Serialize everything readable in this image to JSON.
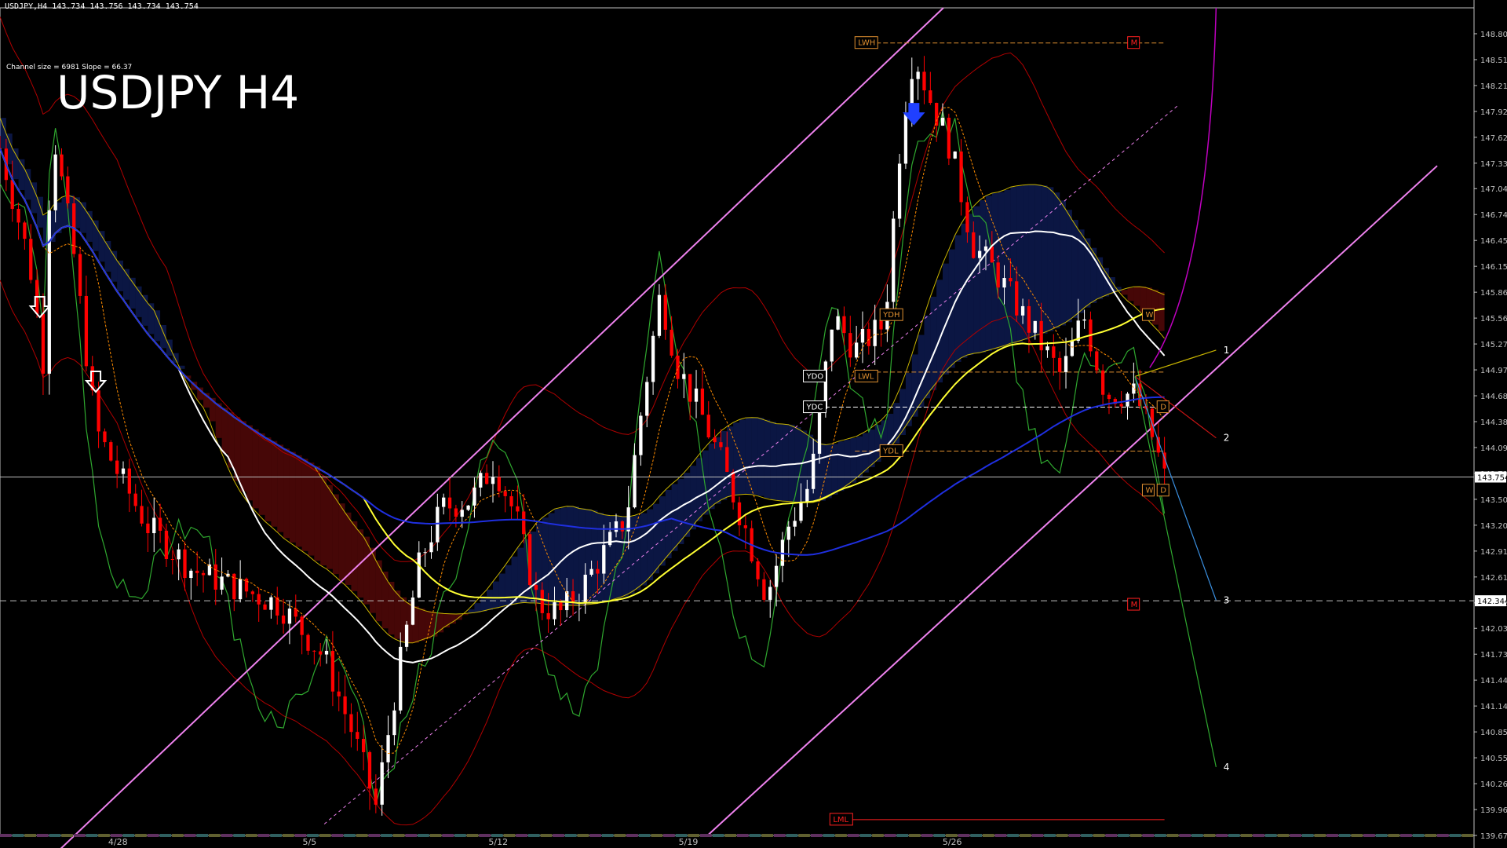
{
  "header": {
    "symbol_line": "USDJPY,H4  143.734 143.756 143.734 143.754",
    "channel_info": "Channel size = 6981 Slope = 66.37",
    "big_title": "USDJPY H4"
  },
  "colors": {
    "background": "#000000",
    "bull_candle": "#ffffff",
    "bear_candle": "#ff0000",
    "channel": "#ee82ee",
    "ma_blue": "#1f2fe0",
    "ma_yellow": "#ffff33",
    "ma_white": "#ffffff",
    "oscillator_green": "#2fa82f",
    "cloud_red": "#c81414",
    "cloud_blue": "#2040c0",
    "label_orange": "#e09030"
  },
  "chart_data": {
    "type": "candlestick",
    "symbol": "USDJPY",
    "timeframe": "H4",
    "ylim": [
      139.67,
      149.1
    ],
    "y_ticks": [
      "148.805",
      "148.510",
      "148.215",
      "147.920",
      "147.625",
      "147.330",
      "147.040",
      "146.745",
      "146.450",
      "146.155",
      "145.860",
      "145.565",
      "145.270",
      "144.975",
      "144.680",
      "144.385",
      "144.090",
      "143.795",
      "143.500",
      "143.205",
      "142.910",
      "142.615",
      "142.320",
      "142.030",
      "141.735",
      "141.440",
      "141.145",
      "140.850",
      "140.555",
      "140.260",
      "139.965",
      "139.670"
    ],
    "x_labels": [
      {
        "label": "4/28",
        "x": 0.08
      },
      {
        "label": "5/5",
        "x": 0.21
      },
      {
        "label": "5/12",
        "x": 0.338
      },
      {
        "label": "5/19",
        "x": 0.467
      },
      {
        "label": "5/26",
        "x": 0.646
      }
    ],
    "current_price": 143.754,
    "current_price_label": "143.754",
    "second_price_label": "142.344",
    "second_price": 142.344,
    "price_path": [
      [
        0.0,
        147.5
      ],
      [
        0.02,
        146.2
      ],
      [
        0.03,
        145.0
      ],
      [
        0.035,
        147.8
      ],
      [
        0.05,
        146.3
      ],
      [
        0.065,
        144.3
      ],
      [
        0.08,
        143.8
      ],
      [
        0.1,
        143.2
      ],
      [
        0.13,
        142.7
      ],
      [
        0.16,
        142.5
      ],
      [
        0.19,
        142.3
      ],
      [
        0.22,
        141.7
      ],
      [
        0.24,
        140.8
      ],
      [
        0.255,
        140.0
      ],
      [
        0.27,
        141.5
      ],
      [
        0.285,
        142.8
      ],
      [
        0.3,
        143.4
      ],
      [
        0.32,
        143.5
      ],
      [
        0.335,
        143.9
      ],
      [
        0.35,
        143.3
      ],
      [
        0.365,
        142.3
      ],
      [
        0.38,
        142.2
      ],
      [
        0.395,
        142.5
      ],
      [
        0.41,
        142.9
      ],
      [
        0.425,
        143.3
      ],
      [
        0.435,
        144.5
      ],
      [
        0.448,
        145.85
      ],
      [
        0.46,
        145.0
      ],
      [
        0.475,
        144.5
      ],
      [
        0.49,
        143.9
      ],
      [
        0.505,
        143.2
      ],
      [
        0.52,
        142.4
      ],
      [
        0.535,
        143.2
      ],
      [
        0.55,
        143.7
      ],
      [
        0.565,
        145.6
      ],
      [
        0.58,
        145.2
      ],
      [
        0.6,
        145.5
      ],
      [
        0.612,
        147.8
      ],
      [
        0.62,
        148.6
      ],
      [
        0.63,
        148.1
      ],
      [
        0.645,
        147.5
      ],
      [
        0.66,
        146.4
      ],
      [
        0.675,
        146.1
      ],
      [
        0.69,
        145.7
      ],
      [
        0.705,
        145.3
      ],
      [
        0.72,
        144.9
      ],
      [
        0.735,
        145.6
      ],
      [
        0.75,
        144.7
      ],
      [
        0.77,
        144.7
      ],
      [
        0.782,
        144.2
      ],
      [
        0.79,
        143.75
      ]
    ],
    "candles": [],
    "labels": [
      {
        "text": "LWH",
        "price": 148.7,
        "x": 0.58
      },
      {
        "text": "M",
        "price": 148.7,
        "x": 0.765
      },
      {
        "text": "YDH",
        "price": 145.6,
        "x": 0.597
      },
      {
        "text": "W",
        "price": 145.6,
        "x": 0.775
      },
      {
        "text": "YDO",
        "price": 144.9,
        "x": 0.545
      },
      {
        "text": "LWL",
        "price": 144.9,
        "x": 0.58
      },
      {
        "text": "YDC",
        "price": 144.55,
        "x": 0.545
      },
      {
        "text": "D",
        "price": 144.55,
        "x": 0.785
      },
      {
        "text": "YDL",
        "price": 144.05,
        "x": 0.597
      },
      {
        "text": "W",
        "price": 143.6,
        "x": 0.775
      },
      {
        "text": "D",
        "price": 143.6,
        "x": 0.785
      },
      {
        "text": "M",
        "price": 142.3,
        "x": 0.765
      },
      {
        "text": "LML",
        "price": 139.85,
        "x": 0.563
      }
    ],
    "projection_labels": [
      {
        "text": "1",
        "x": 0.83,
        "price": 145.2
      },
      {
        "text": "2",
        "x": 0.83,
        "price": 144.2
      },
      {
        "text": "3",
        "x": 0.83,
        "price": 142.35
      },
      {
        "text": "4",
        "x": 0.83,
        "price": 140.45
      }
    ]
  }
}
